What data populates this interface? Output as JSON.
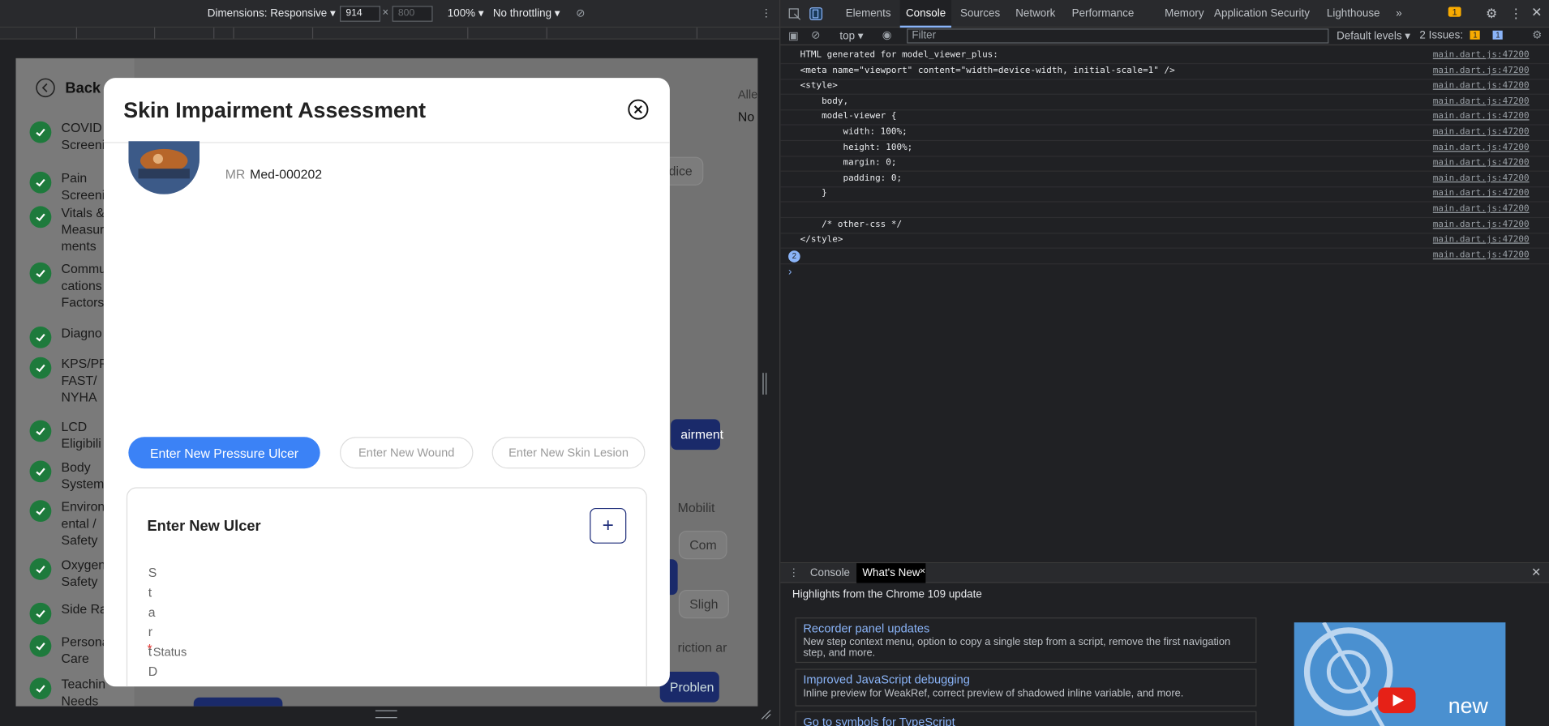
{
  "device_toolbar": {
    "dimensions": "Dimensions: Responsive ▾",
    "width": "914",
    "height": "800",
    "zoom": "100% ▾",
    "throttling": "No throttling ▾"
  },
  "app": {
    "back_label": "Back",
    "sidebar": [
      {
        "label": "COVID Screeni"
      },
      {
        "label": "Pain Screeni"
      },
      {
        "label": "Vitals & Measure ments"
      },
      {
        "label": "Commu cations Factors"
      },
      {
        "label": "Diagno"
      },
      {
        "label": "KPS/PP FAST/ NYHA"
      },
      {
        "label": "LCD Eligibili"
      },
      {
        "label": "Body System"
      },
      {
        "label": "Environ ental / Safety"
      },
      {
        "label": "Oxygen Safety"
      },
      {
        "label": "Side Ra"
      },
      {
        "label": "Persona Care"
      },
      {
        "label": "Teachin Needs"
      }
    ],
    "bg_texts": {
      "alle": "Alle",
      "no": "No",
      "dice": "dice",
      "airment": "airment",
      "mobility": "Mobilit",
      "com": "Com",
      "sligh": "Sligh",
      "riction": "riction ar",
      "problem": "Problen"
    }
  },
  "modal": {
    "title": "Skin Impairment Assessment",
    "mr_label": "MR",
    "mr_value": "Med-000202",
    "buttons": [
      "Enter New Pressure Ulcer",
      "Enter New Wound",
      "Enter New Skin Lesion"
    ],
    "card_title": "Enter New Ulcer",
    "add_symbol": "+",
    "vertical_chars": [
      "S",
      "t",
      "a",
      "r",
      "t",
      "D"
    ],
    "required": "*",
    "status_label": "Status"
  },
  "devtools": {
    "tabs": [
      "Elements",
      "Console",
      "Sources",
      "Network",
      "Performance",
      "Memory",
      "Application",
      "Security",
      "Lighthouse",
      "»"
    ],
    "active_tab": "Console",
    "issues_badge": "1",
    "console_toolbar": {
      "context": "top ▾",
      "filter_placeholder": "Filter",
      "levels": "Default levels ▾",
      "issues": "2 Issues:",
      "issues_warn": "1",
      "issues_info": "1"
    },
    "log_lines": [
      {
        "text": "HTML generated for model_viewer_plus:",
        "src": "main.dart.js:47200"
      },
      {
        "text": "<meta name=\"viewport\" content=\"width=device-width, initial-scale=1\" />",
        "src": "main.dart.js:47200"
      },
      {
        "text": "<style>",
        "src": "main.dart.js:47200"
      },
      {
        "text": "    body,",
        "src": "main.dart.js:47200"
      },
      {
        "text": "    model-viewer {",
        "src": "main.dart.js:47200"
      },
      {
        "text": "        width: 100%;",
        "src": "main.dart.js:47200"
      },
      {
        "text": "        height: 100%;",
        "src": "main.dart.js:47200"
      },
      {
        "text": "        margin: 0;",
        "src": "main.dart.js:47200"
      },
      {
        "text": "        padding: 0;",
        "src": "main.dart.js:47200"
      },
      {
        "text": "    }",
        "src": "main.dart.js:47200"
      },
      {
        "text": "",
        "src": "main.dart.js:47200"
      },
      {
        "text": "    /* other-css */",
        "src": "main.dart.js:47200"
      },
      {
        "text": "</style>",
        "src": "main.dart.js:47200"
      },
      {
        "text": "",
        "src": "main.dart.js:47200",
        "count": "2"
      }
    ],
    "drawer": {
      "tabs": [
        "Console",
        "What's New"
      ],
      "active": "What's New",
      "headline": "Highlights from the Chrome 109 update",
      "features": [
        {
          "title": "Recorder panel updates",
          "desc": "New step context menu, option to copy a single step from a script, remove the first navigation step, and more."
        },
        {
          "title": "Improved JavaScript debugging",
          "desc": "Inline preview for WeakRef, correct preview of shadowed inline variable, and more."
        },
        {
          "title": "Go to symbols for TypeScript",
          "desc": ""
        }
      ],
      "video_text": "new"
    }
  }
}
